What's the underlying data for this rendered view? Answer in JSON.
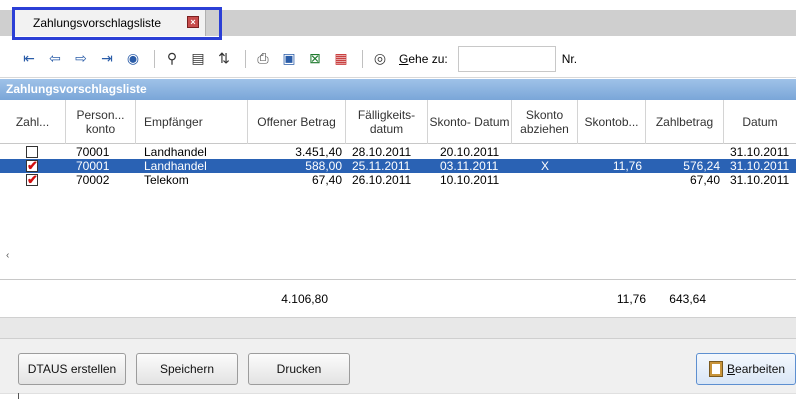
{
  "tab": {
    "title": "Zahlungsvorschlagsliste",
    "close_icon": "close-icon"
  },
  "toolbar": {
    "icons": [
      "first-icon",
      "prev-icon",
      "next-icon",
      "last-icon",
      "refresh-icon",
      "search-icon",
      "preview-icon",
      "filter-icon",
      "print-icon",
      "save-icon",
      "excel-icon",
      "pdf-icon",
      "help-icon"
    ],
    "goto_label_prefix": "",
    "goto_label_accel": "G",
    "goto_label_rest": "ehe zu:",
    "goto_value": "",
    "goto_suffix": "Nr."
  },
  "panel": {
    "title": "Zahlungsvorschlagsliste"
  },
  "grid": {
    "columns": [
      "Zahl...",
      "Person... konto",
      "Empfänger",
      "Offener Betrag",
      "Fälligkeits- datum",
      "Skonto- Datum",
      "Skonto abziehen",
      "Skontob...",
      "Zahlbetrag",
      "Datum"
    ],
    "rows": [
      {
        "checked": false,
        "konto": "70001",
        "empfaenger": "Landhandel",
        "betrag": "3.451,40",
        "faellig": "28.10.2011",
        "skontodatum": "20.10.2011",
        "abziehen": "",
        "skontob": "",
        "zahlbetrag": "",
        "datum": "31.10.2011"
      },
      {
        "checked": true,
        "konto": "70001",
        "empfaenger": "Landhandel",
        "betrag": "588,00",
        "faellig": "25.11.2011",
        "skontodatum": "03.11.2011",
        "abziehen": "X",
        "skontob": "11,76",
        "zahlbetrag": "576,24",
        "datum": "31.10.2011"
      },
      {
        "checked": true,
        "konto": "70002",
        "empfaenger": "Telekom",
        "betrag": "67,40",
        "faellig": "26.10.2011",
        "skontodatum": "10.10.2011",
        "abziehen": "",
        "skontob": "",
        "zahlbetrag": "67,40",
        "datum": "31.10.2011"
      }
    ],
    "selected_row": 1,
    "totals": {
      "betrag": "4.106,80",
      "skontob": "11,76",
      "zahlbetrag": "643,64"
    }
  },
  "buttons": {
    "dtaus": "DTAUS erstellen",
    "speichern": "Speichern",
    "drucken": "Drucken",
    "bearbeiten_accel": "B",
    "bearbeiten_rest": "earbeiten"
  },
  "colors": {
    "selection": "#2a62b4",
    "panel_header": "#8db4e0",
    "tab_focus": "#2b3fd6",
    "check_mark": "#d01010"
  }
}
